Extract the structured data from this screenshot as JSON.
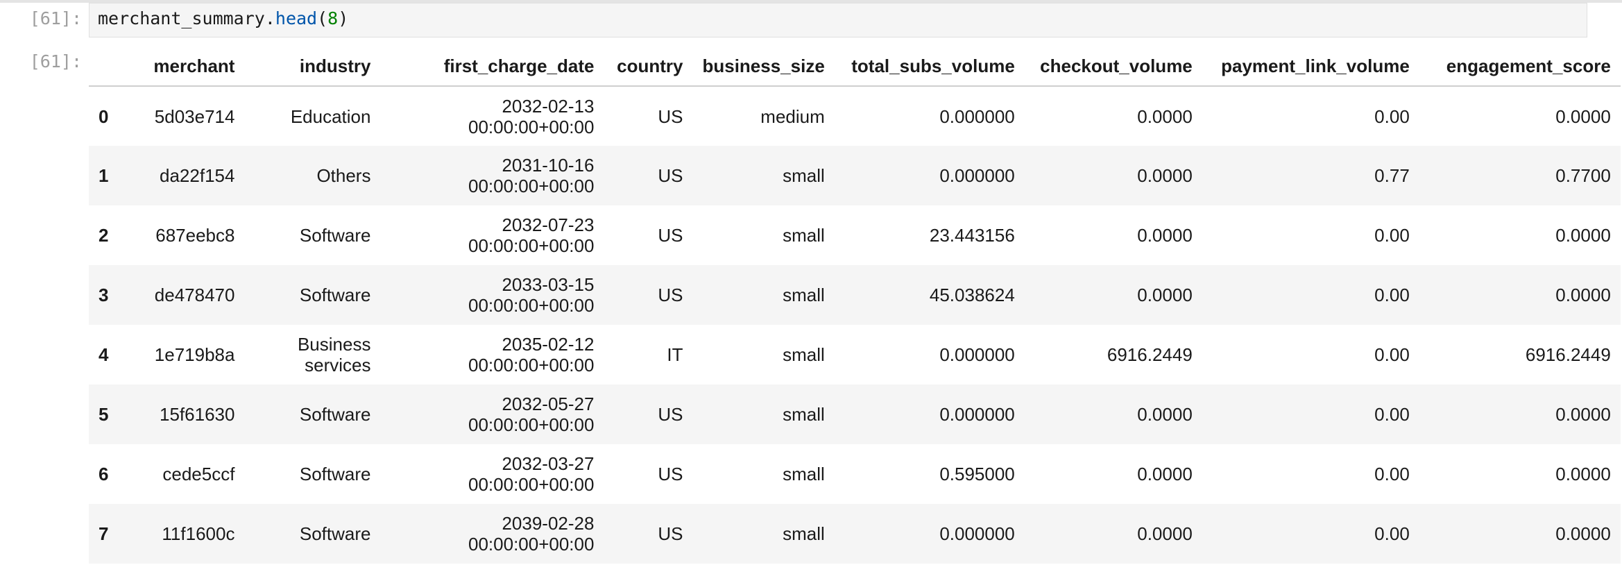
{
  "input": {
    "prompt": "[61]:",
    "code_var": "merchant_summary",
    "code_dot": ".",
    "code_fn": "head",
    "code_open": "(",
    "code_arg": "8",
    "code_close": ")"
  },
  "output": {
    "prompt": "[61]:",
    "columns": [
      "merchant",
      "industry",
      "first_charge_date",
      "country",
      "business_size",
      "total_subs_volume",
      "checkout_volume",
      "payment_link_volume",
      "engagement_score"
    ],
    "rows": [
      {
        "index": "0",
        "merchant": "5d03e714",
        "industry": "Education",
        "date": "2032-02-13",
        "time": "00:00:00+00:00",
        "country": "US",
        "business_size": "medium",
        "total_subs_volume": "0.000000",
        "checkout_volume": "0.0000",
        "payment_link_volume": "0.00",
        "engagement_score": "0.0000"
      },
      {
        "index": "1",
        "merchant": "da22f154",
        "industry": "Others",
        "date": "2031-10-16",
        "time": "00:00:00+00:00",
        "country": "US",
        "business_size": "small",
        "total_subs_volume": "0.000000",
        "checkout_volume": "0.0000",
        "payment_link_volume": "0.77",
        "engagement_score": "0.7700"
      },
      {
        "index": "2",
        "merchant": "687eebc8",
        "industry": "Software",
        "date": "2032-07-23",
        "time": "00:00:00+00:00",
        "country": "US",
        "business_size": "small",
        "total_subs_volume": "23.443156",
        "checkout_volume": "0.0000",
        "payment_link_volume": "0.00",
        "engagement_score": "0.0000"
      },
      {
        "index": "3",
        "merchant": "de478470",
        "industry": "Software",
        "date": "2033-03-15",
        "time": "00:00:00+00:00",
        "country": "US",
        "business_size": "small",
        "total_subs_volume": "45.038624",
        "checkout_volume": "0.0000",
        "payment_link_volume": "0.00",
        "engagement_score": "0.0000"
      },
      {
        "index": "4",
        "merchant": "1e719b8a",
        "industry": "Business services",
        "date": "2035-02-12",
        "time": "00:00:00+00:00",
        "country": "IT",
        "business_size": "small",
        "total_subs_volume": "0.000000",
        "checkout_volume": "6916.2449",
        "payment_link_volume": "0.00",
        "engagement_score": "6916.2449"
      },
      {
        "index": "5",
        "merchant": "15f61630",
        "industry": "Software",
        "date": "2032-05-27",
        "time": "00:00:00+00:00",
        "country": "US",
        "business_size": "small",
        "total_subs_volume": "0.000000",
        "checkout_volume": "0.0000",
        "payment_link_volume": "0.00",
        "engagement_score": "0.0000"
      },
      {
        "index": "6",
        "merchant": "cede5ccf",
        "industry": "Software",
        "date": "2032-03-27",
        "time": "00:00:00+00:00",
        "country": "US",
        "business_size": "small",
        "total_subs_volume": "0.595000",
        "checkout_volume": "0.0000",
        "payment_link_volume": "0.00",
        "engagement_score": "0.0000"
      },
      {
        "index": "7",
        "merchant": "11f1600c",
        "industry": "Software",
        "date": "2039-02-28",
        "time": "00:00:00+00:00",
        "country": "US",
        "business_size": "small",
        "total_subs_volume": "0.000000",
        "checkout_volume": "0.0000",
        "payment_link_volume": "0.00",
        "engagement_score": "0.0000"
      }
    ]
  }
}
